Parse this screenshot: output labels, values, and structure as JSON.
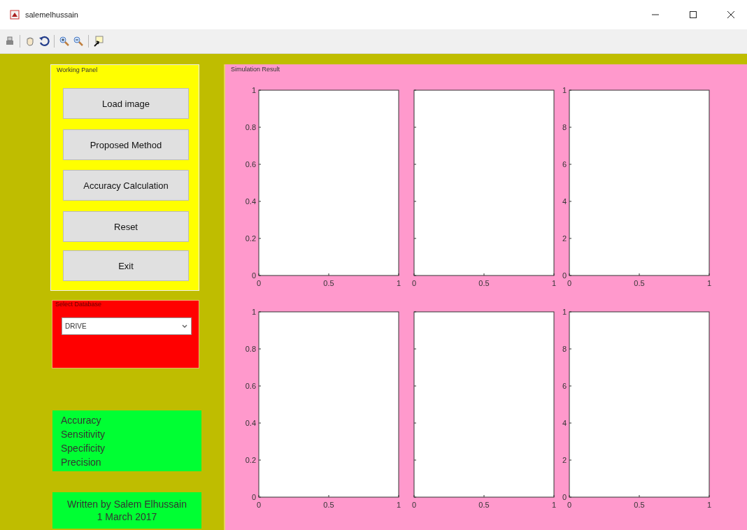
{
  "window": {
    "title": "salemelhussain"
  },
  "toolbar": [
    {
      "kind": "print"
    },
    {
      "kind": "pan"
    },
    {
      "kind": "rotate"
    },
    {
      "kind": "zoom-in"
    },
    {
      "kind": "zoom-out"
    },
    {
      "kind": "data-cursor"
    }
  ],
  "working_panel": {
    "title": "Working Panel",
    "buttons": [
      "Load image",
      "Proposed Method",
      "Accuracy Calculation",
      "Reset",
      "Exit"
    ]
  },
  "database_panel": {
    "title": "Select Database",
    "dropdown": {
      "value": "DRIVE"
    }
  },
  "metrics": [
    "Accuracy",
    "Sensitivity",
    "Specificity",
    "Precision"
  ],
  "credit": [
    "Written by Salem Elhussain",
    "1 March 2017"
  ],
  "results_panel": {
    "title": "Simulation Result",
    "axes": [
      {
        "x_labels": [
          "0",
          "0.5",
          "1"
        ],
        "y_labels": [
          "1",
          "0.8",
          "0.6",
          "0.4",
          "0.2",
          "0"
        ]
      },
      {
        "x_labels": [
          "0",
          "0.5",
          "1"
        ]
      },
      {
        "x_labels": [
          "0",
          "0.5",
          "1"
        ],
        "y_labels": [
          "1",
          "8",
          "6",
          "4",
          "2",
          "0"
        ]
      },
      {
        "x_labels": [
          "0",
          "0.5",
          "1"
        ],
        "y_labels": [
          "1",
          "0.8",
          "0.6",
          "0.4",
          "0.2",
          "0"
        ]
      },
      {
        "x_labels": [
          "0",
          "0.5",
          "1"
        ]
      },
      {
        "x_labels": [
          "0",
          "0.5",
          "1"
        ],
        "y_labels": [
          "1",
          "8",
          "6",
          "4",
          "2",
          "0"
        ]
      }
    ]
  }
}
